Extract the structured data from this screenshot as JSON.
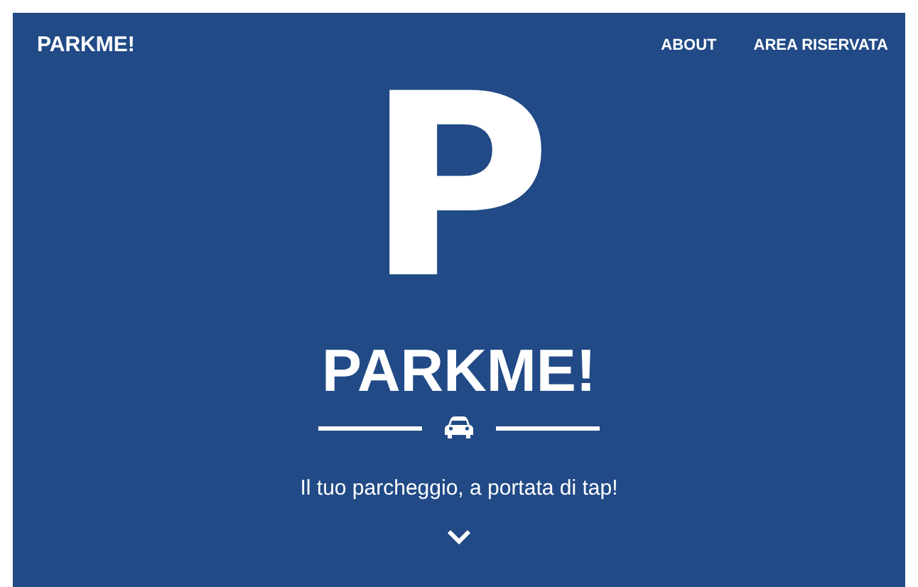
{
  "navbar": {
    "brand": "PARKME!",
    "links": [
      {
        "label": "ABOUT"
      },
      {
        "label": "AREA RISERVATA"
      }
    ]
  },
  "hero": {
    "logo_letter": "P",
    "title": "PARKME!",
    "subtitle": "Il tuo parcheggio, a portata di tap!"
  }
}
